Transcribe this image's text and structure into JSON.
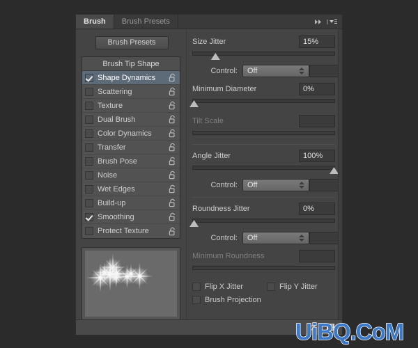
{
  "window": {
    "background_color": "#2b2b2b",
    "panel_background": "#444444"
  },
  "tabs": [
    {
      "label": "Brush",
      "active": true
    },
    {
      "label": "Brush Presets",
      "active": false
    }
  ],
  "tab_buttons": [
    {
      "name": "collapse-panel-icon",
      "glyph": "»"
    },
    {
      "name": "panel-menu-icon",
      "glyph": "≡"
    }
  ],
  "left": {
    "presets_button": "Brush Presets",
    "list_header": "Brush Tip Shape",
    "options": [
      {
        "label": "Shape Dynamics",
        "checked": true,
        "selected": true
      },
      {
        "label": "Scattering",
        "checked": false,
        "selected": false
      },
      {
        "label": "Texture",
        "checked": false,
        "selected": false
      },
      {
        "label": "Dual Brush",
        "checked": false,
        "selected": false
      },
      {
        "label": "Color Dynamics",
        "checked": false,
        "selected": false
      },
      {
        "label": "Transfer",
        "checked": false,
        "selected": false
      },
      {
        "label": "Brush Pose",
        "checked": false,
        "selected": false
      },
      {
        "label": "Noise",
        "checked": false,
        "selected": false
      },
      {
        "label": "Wet Edges",
        "checked": false,
        "selected": false
      },
      {
        "label": "Build-up",
        "checked": false,
        "selected": false
      },
      {
        "label": "Smoothing",
        "checked": true,
        "selected": false
      },
      {
        "label": "Protect Texture",
        "checked": false,
        "selected": false
      }
    ],
    "preview_name": "brush-stroke-preview"
  },
  "right": {
    "size_jitter": {
      "label": "Size Jitter",
      "value": "15%",
      "slider_percent": 15
    },
    "size_jitter_control": {
      "label": "Control:",
      "value": "Off",
      "extra_value": ""
    },
    "minimum_diameter": {
      "label": "Minimum Diameter",
      "value": "0%",
      "slider_percent": 0
    },
    "tilt_scale": {
      "label": "Tilt Scale",
      "value": "",
      "disabled": true,
      "slider_percent": 0
    },
    "angle_jitter": {
      "label": "Angle Jitter",
      "value": "100%",
      "slider_percent": 100
    },
    "angle_jitter_control": {
      "label": "Control:",
      "value": "Off",
      "extra_value": ""
    },
    "roundness_jitter": {
      "label": "Roundness Jitter",
      "value": "0%",
      "slider_percent": 0
    },
    "roundness_jitter_control": {
      "label": "Control:",
      "value": "Off",
      "extra_value": ""
    },
    "minimum_roundness": {
      "label": "Minimum Roundness",
      "value": "",
      "disabled": true,
      "slider_percent": 0
    },
    "checkboxes": [
      {
        "label": "Flip X Jitter",
        "checked": false
      },
      {
        "label": "Flip Y Jitter",
        "checked": false
      },
      {
        "label": "Brush Projection",
        "checked": false
      }
    ]
  },
  "footer": {
    "icons": [
      {
        "name": "toggle-brush-settings-icon",
        "glyph": "⊘"
      },
      {
        "name": "new-brush-preset-icon",
        "glyph": "▤"
      }
    ]
  },
  "watermark": {
    "text": "UiBQ.CoM",
    "color": "#3c78c8"
  }
}
